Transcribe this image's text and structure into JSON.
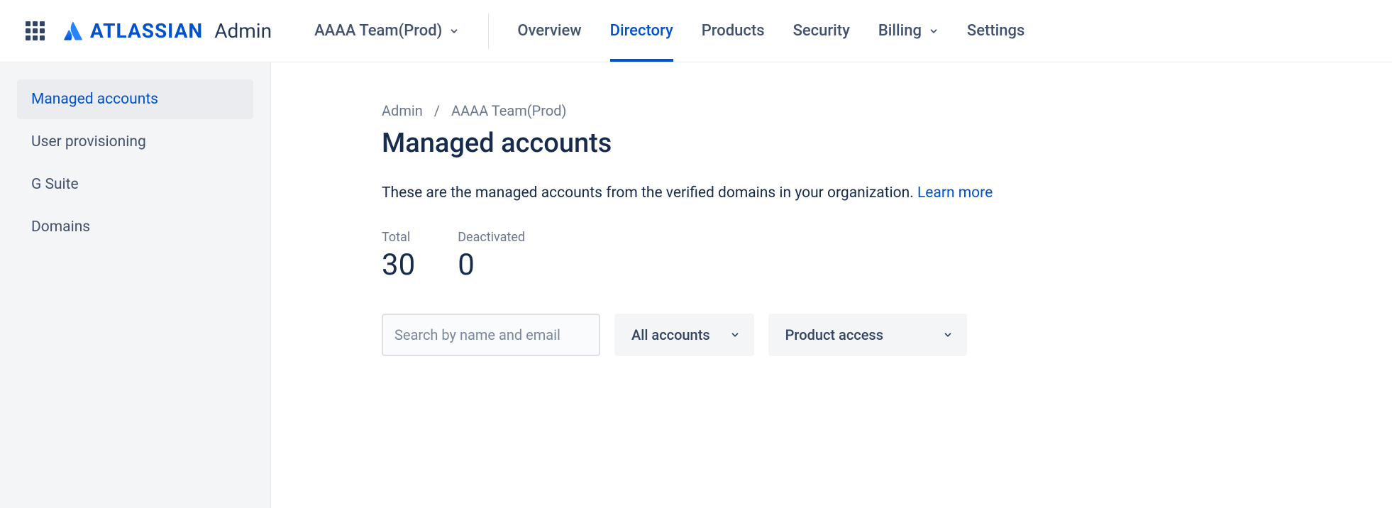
{
  "header": {
    "brand": "ATLASSIAN",
    "brand_suffix": "Admin",
    "org": "AAAA Team(Prod)",
    "nav": [
      {
        "label": "Overview",
        "active": false
      },
      {
        "label": "Directory",
        "active": true
      },
      {
        "label": "Products",
        "active": false
      },
      {
        "label": "Security",
        "active": false
      },
      {
        "label": "Billing",
        "active": false,
        "dropdown": true
      },
      {
        "label": "Settings",
        "active": false
      }
    ]
  },
  "sidebar": {
    "items": [
      {
        "label": "Managed accounts",
        "active": true
      },
      {
        "label": "User provisioning",
        "active": false
      },
      {
        "label": "G Suite",
        "active": false
      },
      {
        "label": "Domains",
        "active": false
      }
    ]
  },
  "breadcrumb": {
    "items": [
      "Admin",
      "AAAA Team(Prod)"
    ]
  },
  "page": {
    "title": "Managed accounts",
    "description": "These are the managed accounts from the verified domains in your organization. ",
    "learn_more": "Learn more"
  },
  "stats": {
    "total_label": "Total",
    "total_value": "30",
    "deactivated_label": "Deactivated",
    "deactivated_value": "0"
  },
  "toolbar": {
    "search_placeholder": "Search by name and email",
    "filter_accounts": "All accounts",
    "filter_product": "Product access"
  }
}
